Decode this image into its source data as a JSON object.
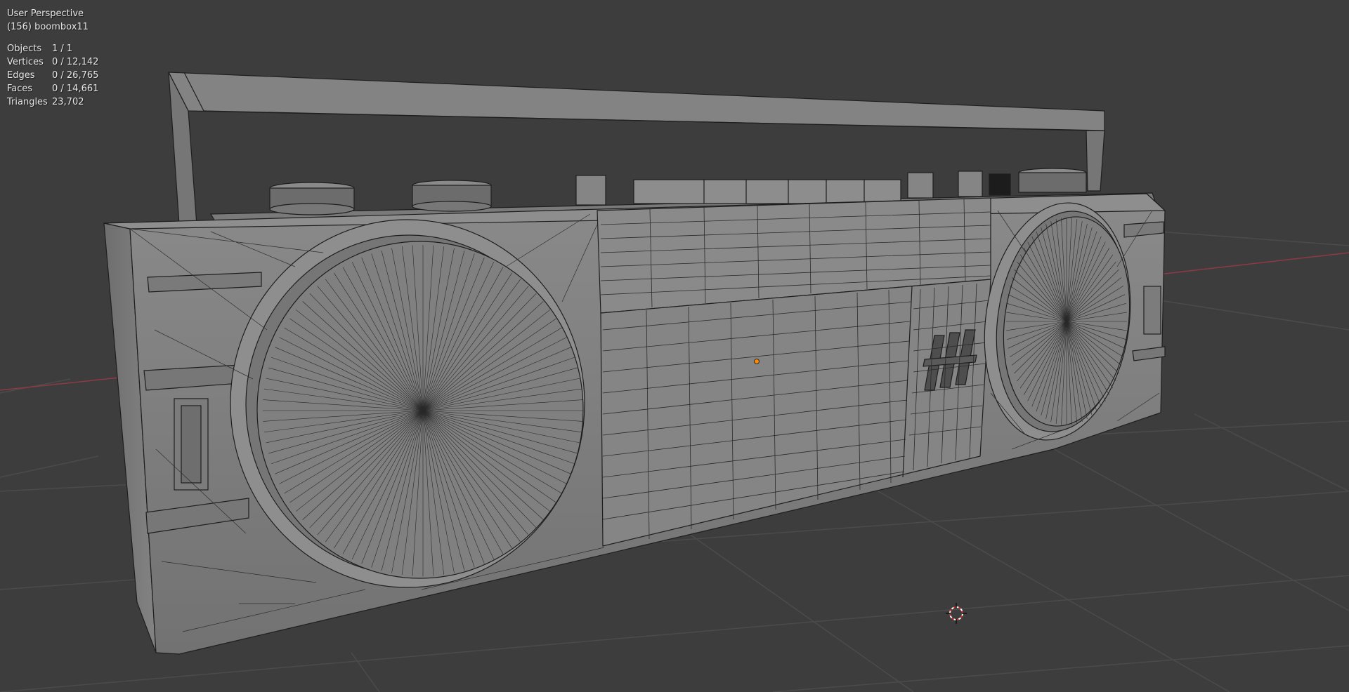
{
  "viewport": {
    "view_name": "User Perspective",
    "active_object": "(156) boombox11",
    "stats": [
      {
        "label": "Objects",
        "value": "1 / 1"
      },
      {
        "label": "Vertices",
        "value": "0 / 12,142"
      },
      {
        "label": "Edges",
        "value": "0 / 26,765"
      },
      {
        "label": "Faces",
        "value": "0 / 14,661"
      },
      {
        "label": "Triangles",
        "value": "23,702"
      }
    ]
  },
  "colors": {
    "background": "#3d3d3d",
    "grid": "#4a4a4a",
    "x_axis": "#8e3a44",
    "mesh_face": "#7d7d7d",
    "mesh_wire": "#1e1e1e",
    "origin": "#ff8a00",
    "cursor_red": "#d62828"
  },
  "icons": {
    "origin": "object-origin-dot-icon",
    "cursor": "3d-cursor-icon"
  }
}
